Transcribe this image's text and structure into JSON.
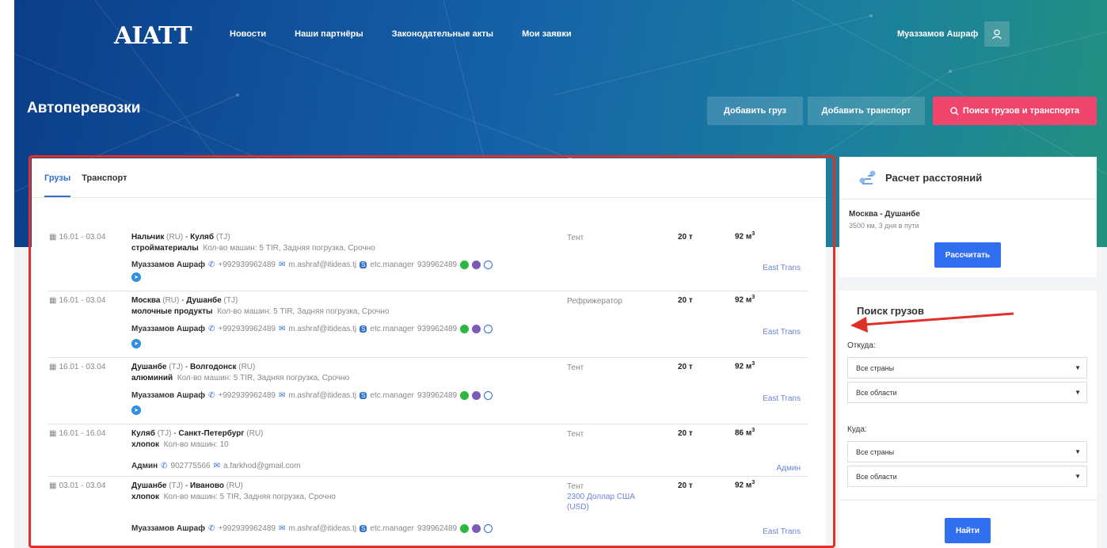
{
  "header": {
    "logo": "AIATT",
    "nav": [
      "Новости",
      "Наши партнёры",
      "Законодательные акты",
      "Мои заявки"
    ],
    "user_name": "Муаззамов Ашраф"
  },
  "page": {
    "title": "Автоперевозки",
    "btn_add_cargo": "Добавить груз",
    "btn_add_transport": "Добавить транспорт",
    "btn_search": "Поиск грузов и транспорта"
  },
  "tabs": [
    "Грузы",
    "Транспорт"
  ],
  "rows": [
    {
      "date": "16.01 - 03.04",
      "from": "Нальчик",
      "from_cc": "(RU)",
      "to": "Куляб",
      "to_cc": "(TJ)",
      "cargo": "стройматериалы",
      "details": "Кол-во машин: 5   TIR, Задняя погрузка, Срочно",
      "contact_name": "Муаззамов Ашраф",
      "phone": "+992939962489",
      "email": "m.ashraf@itideas.tj",
      "skype": "etc.manager",
      "phone2": "939962489",
      "type": "Тент",
      "weight": "20 т",
      "volume": "92 м",
      "company": "East Trans"
    },
    {
      "date": "16.01 - 03.04",
      "from": "Москва",
      "from_cc": "(RU)",
      "to": "Душанбе",
      "to_cc": "(TJ)",
      "cargo": "молочные продукты",
      "details": "Кол-во машин: 5   TIR, Задняя погрузка, Срочно",
      "contact_name": "Муаззамов Ашраф",
      "phone": "+992939962489",
      "email": "m.ashraf@itideas.tj",
      "skype": "etc.manager",
      "phone2": "939962489",
      "type": "Рефрижератор",
      "weight": "20 т",
      "volume": "92 м",
      "company": "East Trans"
    },
    {
      "date": "16.01 - 03.04",
      "from": "Душанбе",
      "from_cc": "(TJ)",
      "to": "Волгодонск",
      "to_cc": "(RU)",
      "cargo": "алюминий",
      "details": "Кол-во машин: 5   TIR, Задняя погрузка, Срочно",
      "contact_name": "Муаззамов Ашраф",
      "phone": "+992939962489",
      "email": "m.ashraf@itideas.tj",
      "skype": "etc.manager",
      "phone2": "939962489",
      "type": "Тент",
      "weight": "20 т",
      "volume": "92 м",
      "company": "East Trans"
    },
    {
      "date": "16.01 - 16.04",
      "from": "Куляб",
      "from_cc": "(TJ)",
      "to": "Санкт-Петербург",
      "to_cc": "(RU)",
      "cargo": "хлопок",
      "details": "Кол-во машин: 10",
      "contact_name": "Админ",
      "phone": "902775566",
      "email": "a.farkhod@gmail.com",
      "type": "Тент",
      "weight": "20 т",
      "volume": "86 м",
      "company": "Админ"
    },
    {
      "date": "03.01 - 03.04",
      "from": "Душанбе",
      "from_cc": "(TJ)",
      "to": "Иваново",
      "to_cc": "(RU)",
      "cargo": "хлопок",
      "details": "Кол-во машин: 5   TIR, Задняя погрузка, Срочно",
      "contact_name": "Муаззамов Ашраф",
      "phone": "+992939962489",
      "email": "m.ashraf@itideas.tj",
      "skype": "etc.manager",
      "phone2": "939962489",
      "type": "Тент",
      "price": "2300 Доллар США (USD)",
      "weight": "20 т",
      "volume": "92 м",
      "company": "East Trans"
    }
  ],
  "distance_card": {
    "title": "Расчет расстояний",
    "route": "Москва - Душанбе",
    "info": "3500 км, 3 дня в пути",
    "button": "Рассчитать"
  },
  "search_card": {
    "title": "Поиск грузов",
    "from_label": "Откуда:",
    "to_label": "Куда:",
    "country_all": "Все страны",
    "region_all": "Все области",
    "button": "Найти"
  },
  "volume_unit_sup": "3",
  "colors": {
    "accent": "#2f6ff0",
    "pink": "#f0456c",
    "highlight": "#e0302a"
  }
}
